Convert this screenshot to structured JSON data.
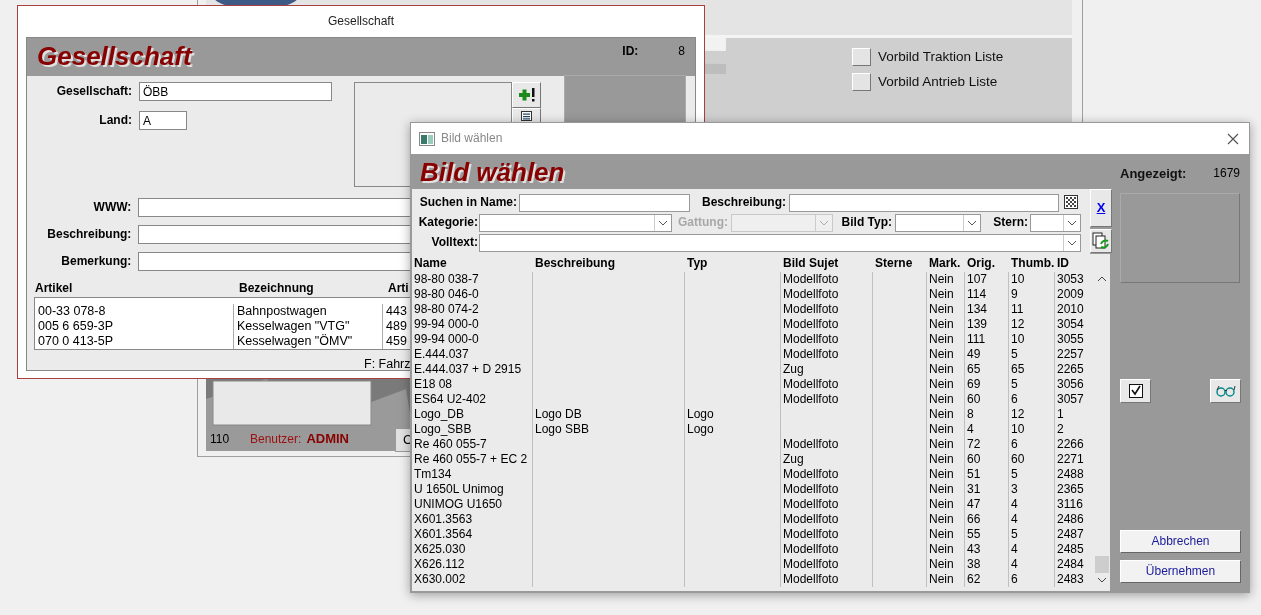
{
  "main_window": {
    "list_buttons": [
      {
        "label": "Vorbild Traktion Liste"
      },
      {
        "label": "Vorbild Antrieb Liste"
      }
    ],
    "status": {
      "count": "110",
      "user_label": "Benutzer:",
      "user": "ADMIN"
    },
    "cut_button": "C"
  },
  "company_window": {
    "title": "Gesellschaft",
    "heading": "Gesellschaft",
    "id_label": "ID:",
    "id": "8",
    "top_fields": [
      {
        "label": "Gesellschaft:",
        "value": "ÖBB"
      },
      {
        "label": "Land:",
        "value": "A"
      }
    ],
    "wide_fields": [
      {
        "label": "WWW:"
      },
      {
        "label": "Beschreibung:"
      },
      {
        "label": "Bemerkung:"
      }
    ],
    "articles": {
      "columns": [
        "Artikel",
        "Bezeichnung",
        "Arti"
      ],
      "rows": [
        [
          "00-33 078-8",
          "Bahnpostwagen",
          "443"
        ],
        [
          "005 6 659-3P",
          "Kesselwagen \"VTG\"",
          "489"
        ],
        [
          "070 0 413-5P",
          "Kesselwagen \"ÖMV\"",
          "459"
        ]
      ]
    },
    "footer": "F: Fahrz"
  },
  "picture_window": {
    "title": "Bild wählen",
    "heading": "Bild wählen",
    "count_label": "Angezeigt:",
    "count": "1679",
    "filter_rows": [
      [
        {
          "kind": "text",
          "label": "Suchen in Name:",
          "disabled": false
        },
        {
          "kind": "text",
          "label": "Beschreibung:",
          "disabled": false
        }
      ],
      [
        {
          "kind": "combo",
          "label": "Kategorie:",
          "disabled": false
        },
        {
          "kind": "combo",
          "label": "Gattung:",
          "disabled": true
        },
        {
          "kind": "combo",
          "label": "Bild Typ:",
          "disabled": false
        },
        {
          "kind": "combo",
          "label": "Stern:",
          "disabled": false
        }
      ],
      [
        {
          "kind": "combo",
          "label": "Volltext:",
          "disabled": false
        }
      ]
    ],
    "clear_link": "X",
    "table": {
      "columns": [
        "Name",
        "Beschreibung",
        "Typ",
        "Bild Sujet",
        "Sterne",
        "Mark.",
        "Orig.",
        "Thumb.",
        "ID"
      ],
      "rows": [
        [
          "98-80 038-7",
          null,
          null,
          "Modellfoto",
          null,
          "Nein",
          "107",
          "10",
          "3053"
        ],
        [
          "98-80 046-0",
          null,
          null,
          "Modellfoto",
          null,
          "Nein",
          "114",
          "9",
          "2009"
        ],
        [
          "98-80 074-2",
          null,
          null,
          "Modellfoto",
          null,
          "Nein",
          "134",
          "11",
          "2010"
        ],
        [
          "99-94 000-0",
          null,
          null,
          "Modellfoto",
          null,
          "Nein",
          "139",
          "12",
          "3054"
        ],
        [
          "99-94 000-0",
          null,
          null,
          "Modellfoto",
          null,
          "Nein",
          "111",
          "10",
          "3055"
        ],
        [
          "E.444.037",
          null,
          null,
          "Modellfoto",
          null,
          "Nein",
          "49",
          "5",
          "2257"
        ],
        [
          "E.444.037 + D 2915",
          null,
          null,
          "Zug",
          null,
          "Nein",
          "65",
          "65",
          "2265"
        ],
        [
          "E18 08",
          null,
          null,
          "Modellfoto",
          null,
          "Nein",
          "69",
          "5",
          "3056"
        ],
        [
          "ES64 U2-402",
          null,
          null,
          "Modellfoto",
          null,
          "Nein",
          "60",
          "6",
          "3057"
        ],
        [
          "Logo_DB",
          "Logo DB",
          "Logo",
          null,
          null,
          "Nein",
          "8",
          "12",
          "1"
        ],
        [
          "Logo_SBB",
          "Logo SBB",
          "Logo",
          null,
          null,
          "Nein",
          "4",
          "10",
          "2"
        ],
        [
          "Re 460 055-7",
          null,
          null,
          "Modellfoto",
          null,
          "Nein",
          "72",
          "6",
          "2266"
        ],
        [
          "Re 460 055-7 + EC 2",
          null,
          null,
          "Zug",
          null,
          "Nein",
          "60",
          "60",
          "2271"
        ],
        [
          "Tm134",
          null,
          null,
          "Modellfoto",
          null,
          "Nein",
          "51",
          "5",
          "2488"
        ],
        [
          "U 1650L Unimog",
          null,
          null,
          "Modellfoto",
          null,
          "Nein",
          "31",
          "3",
          "2365"
        ],
        [
          "UNIMOG U1650",
          null,
          null,
          "Modellfoto",
          null,
          "Nein",
          "47",
          "4",
          "3116"
        ],
        [
          "X601.3563",
          null,
          null,
          "Modellfoto",
          null,
          "Nein",
          "66",
          "4",
          "2486"
        ],
        [
          "X601.3564",
          null,
          null,
          "Modellfoto",
          null,
          "Nein",
          "55",
          "5",
          "2487"
        ],
        [
          "X625.030",
          null,
          null,
          "Modellfoto",
          null,
          "Nein",
          "43",
          "4",
          "2485"
        ],
        [
          "X626.112",
          null,
          null,
          "Modellfoto",
          null,
          "Nein",
          "38",
          "4",
          "2484"
        ],
        [
          "X630.002",
          null,
          null,
          "Modellfoto",
          null,
          "Nein",
          "62",
          "6",
          "2483"
        ]
      ]
    },
    "buttons": [
      "Abbrechen",
      "Übernehmen"
    ]
  }
}
